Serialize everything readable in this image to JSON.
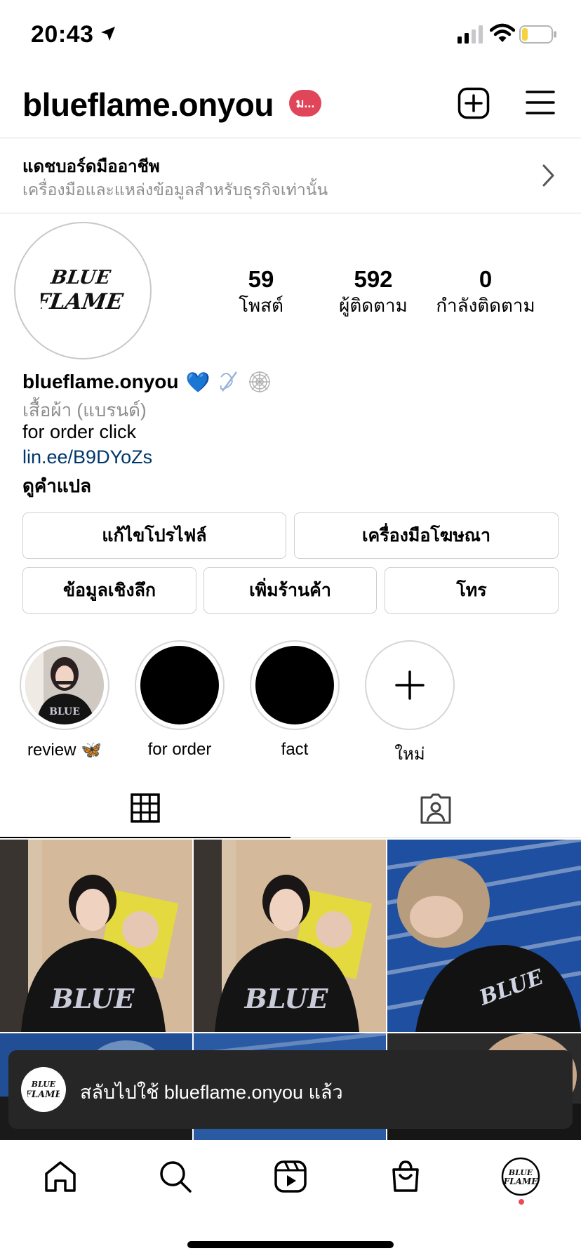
{
  "status_bar": {
    "time": "20:43",
    "icons": [
      "location-arrow-icon",
      "signal-icon",
      "wifi-icon",
      "battery-icon"
    ],
    "battery_level": 0.2,
    "battery_color": "#f5d33b"
  },
  "header": {
    "username": "blueflame.onyou",
    "badge": "ม...",
    "badge_color": "#e0455a",
    "create_icon": "plus-square-icon",
    "menu_icon": "hamburger-menu-icon"
  },
  "dashboard": {
    "title": "แดชบอร์ดมืออาชีพ",
    "subtitle": "เครื่องมือและแหล่งข้อมูลสำหรับธุรกิจเท่านั้น"
  },
  "profile": {
    "avatar_logo": "BLUE FLAME",
    "stats": [
      {
        "value": "59",
        "label": "โพสต์"
      },
      {
        "value": "592",
        "label": "ผู้ติดตาม"
      },
      {
        "value": "0",
        "label": "กำลังติดตาม"
      }
    ],
    "display_name": "blueflame.onyou",
    "name_emoji": "💙",
    "category": "เสื้อผ้า (แบรนด์)",
    "bio_line": "for order click",
    "link": "lin.ee/B9DYoZs",
    "translate": "ดูคำแปล",
    "link_color": "#00376b"
  },
  "buttons": {
    "edit_profile": "แก้ไขโปรไฟล์",
    "ad_tools": "เครื่องมือโฆษณา",
    "insights": "ข้อมูลเชิงลึก",
    "add_shop": "เพิ่มร้านค้า",
    "call": "โทร"
  },
  "highlights": [
    {
      "label": "review 🦋"
    },
    {
      "label": "for order"
    },
    {
      "label": "fact"
    },
    {
      "label": "ใหม่"
    }
  ],
  "tabs": [
    {
      "icon": "grid-icon",
      "active": true
    },
    {
      "icon": "tagged-person-icon",
      "active": false
    }
  ],
  "toast": {
    "text": "สลับไปใช้ blueflame.onyou แล้ว"
  },
  "bottom_nav": {
    "items": [
      "home-icon",
      "search-icon",
      "reels-icon",
      "shop-bag-icon",
      "profile-avatar"
    ],
    "notification_dot_color": "#ed4956"
  }
}
